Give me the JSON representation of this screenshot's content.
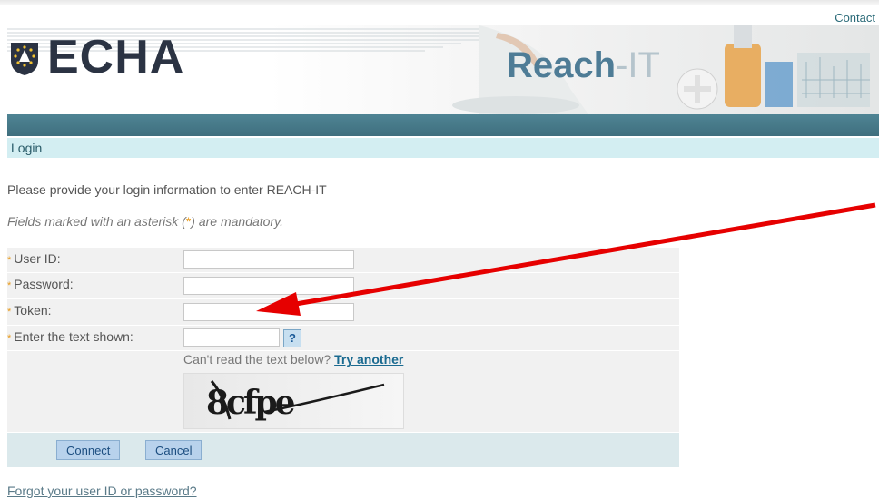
{
  "header": {
    "contact_label": "Contact",
    "logo_text": "ECHA",
    "app_name_main": "Reach",
    "app_name_suffix": "-IT"
  },
  "breadcrumb": {
    "label": "Login"
  },
  "intro": "Please provide your login information to enter REACH-IT",
  "mandatory_note": {
    "before": "Fields marked with an asterisk (",
    "asterisk": "*",
    "after": ") are mandatory."
  },
  "form": {
    "user_id_label": "User ID:",
    "password_label": "Password:",
    "token_label": "Token:",
    "captcha_label": "Enter the text shown:",
    "help_glyph": "?",
    "cant_read_text": "Can't read the text below?",
    "try_another_label": "Try another",
    "captcha_text": "8cfpe",
    "asterisk": "*"
  },
  "buttons": {
    "connect": "Connect",
    "cancel": "Cancel"
  },
  "forgot_link": "Forgot your user ID or password?",
  "colors": {
    "teal": "#4f8494",
    "accent_orange": "#e89a1c",
    "arrow_red": "#e60000"
  }
}
